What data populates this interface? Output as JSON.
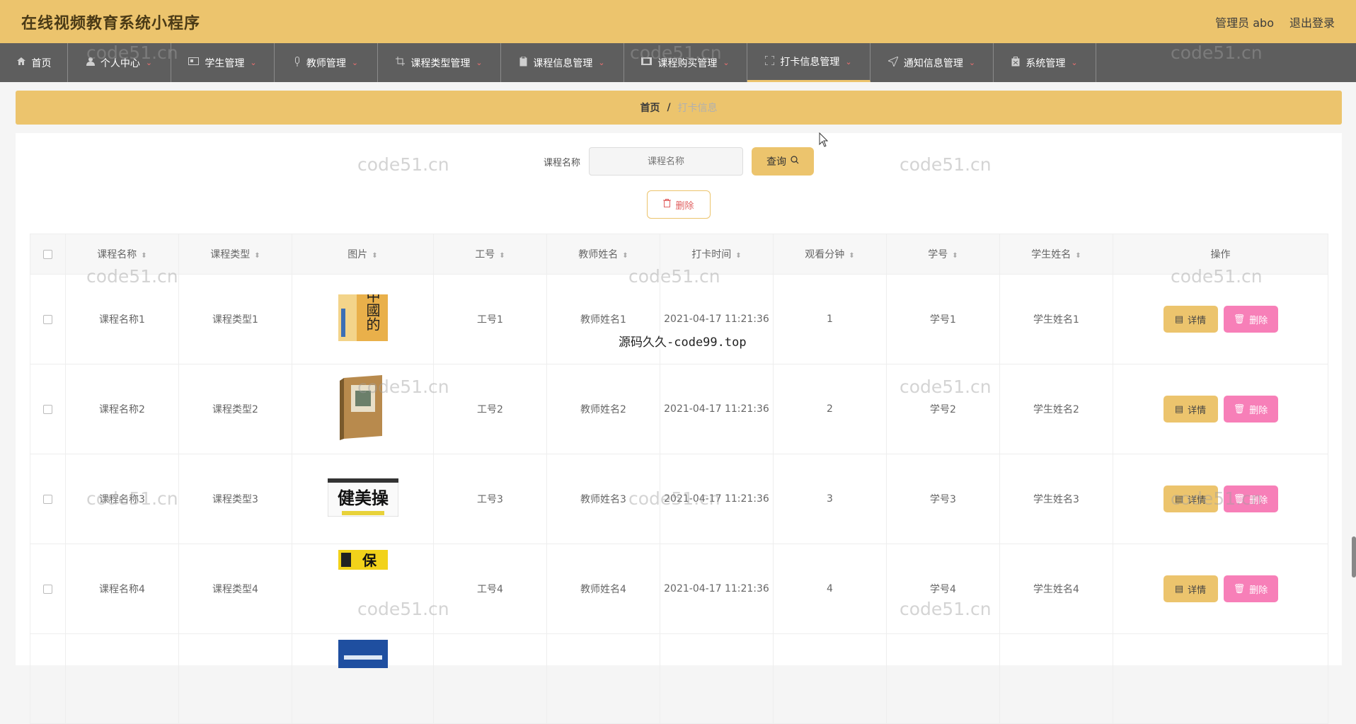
{
  "header": {
    "title": "在线视频教育系统小程序",
    "user_label": "管理员 abo",
    "logout_label": "退出登录"
  },
  "nav": {
    "items": [
      {
        "label": "首页",
        "icon": "home-icon"
      },
      {
        "label": "个人中心",
        "icon": "user-icon"
      },
      {
        "label": "学生管理",
        "icon": "id-card-icon"
      },
      {
        "label": "教师管理",
        "icon": "mic-icon"
      },
      {
        "label": "课程类型管理",
        "icon": "crop-icon"
      },
      {
        "label": "课程信息管理",
        "icon": "clipboard-icon"
      },
      {
        "label": "课程购买管理",
        "icon": "film-icon"
      },
      {
        "label": "打卡信息管理",
        "icon": "fullscreen-icon"
      },
      {
        "label": "通知信息管理",
        "icon": "send-icon"
      },
      {
        "label": "系统管理",
        "icon": "case-icon"
      }
    ]
  },
  "breadcrumb": {
    "home": "首页",
    "separator": "/",
    "current": "打卡信息"
  },
  "search": {
    "label": "课程名称",
    "placeholder": "课程名称",
    "button_label": "查询"
  },
  "batch_delete_label": "删除",
  "table": {
    "headers": [
      "课程名称",
      "课程类型",
      "图片",
      "工号",
      "教师姓名",
      "打卡时间",
      "观看分钟",
      "学号",
      "学生姓名",
      "操作"
    ],
    "rows": [
      {
        "course_name": "课程名称1",
        "course_type": "课程类型1",
        "emp_no": "工号1",
        "teacher": "教师姓名1",
        "time": "2021-04-17 11:21:36",
        "minutes": "1",
        "student_no": "学号1",
        "student": "学生姓名1"
      },
      {
        "course_name": "课程名称2",
        "course_type": "课程类型2",
        "emp_no": "工号2",
        "teacher": "教师姓名2",
        "time": "2021-04-17 11:21:36",
        "minutes": "2",
        "student_no": "学号2",
        "student": "学生姓名2"
      },
      {
        "course_name": "课程名称3",
        "course_type": "课程类型3",
        "emp_no": "工号3",
        "teacher": "教师姓名3",
        "time": "2021-04-17 11:21:36",
        "minutes": "3",
        "student_no": "学号3",
        "student": "学生姓名3"
      },
      {
        "course_name": "课程名称4",
        "course_type": "课程类型4",
        "emp_no": "工号4",
        "teacher": "教师姓名4",
        "time": "2021-04-17 11:21:36",
        "minutes": "4",
        "student_no": "学号4",
        "student": "学生姓名4"
      }
    ],
    "detail_label": "详情",
    "delete_label": "删除"
  },
  "book_covers": {
    "cover1": "中國的",
    "cover3": "健美操",
    "cover4": "保"
  },
  "watermarks": {
    "site": "code51.cn",
    "source": "源码久久-code99.top"
  },
  "colors": {
    "accent": "#ecc46d",
    "nav_bg": "#5e5e5e",
    "delete_pink": "#f77fb8"
  }
}
